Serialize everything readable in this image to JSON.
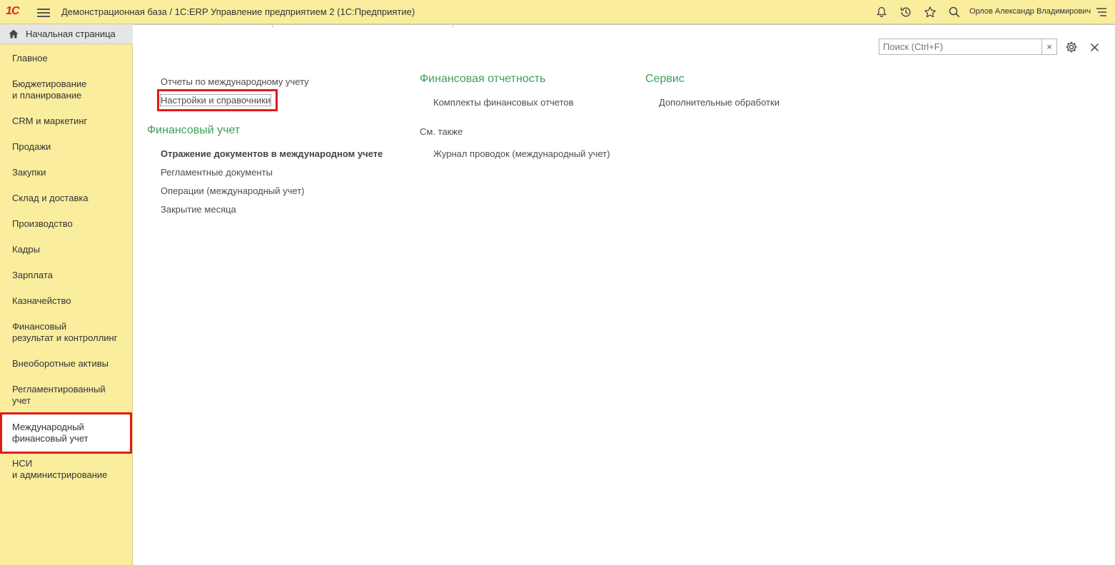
{
  "topbar": {
    "logo": "1С",
    "title": "Демонстрационная база / 1С:ERP Управление предприятием 2  (1С:Предприятие)",
    "user": "Орлов Александр Владимирович",
    "icons": [
      "bell-icon",
      "history-icon",
      "star-icon",
      "search-icon",
      "menu-icon"
    ]
  },
  "sidebar": {
    "home_label": "Начальная страница",
    "items": [
      {
        "label": "Главное"
      },
      {
        "label": "Бюджетирование\nи планирование"
      },
      {
        "label": "CRM и маркетинг"
      },
      {
        "label": "Продажи"
      },
      {
        "label": "Закупки"
      },
      {
        "label": "Склад и доставка"
      },
      {
        "label": "Производство"
      },
      {
        "label": "Кадры"
      },
      {
        "label": "Зарплата"
      },
      {
        "label": "Казначейство"
      },
      {
        "label": "Финансовый\nрезультат и контроллинг"
      },
      {
        "label": "Внеоборотные активы"
      },
      {
        "label": "Регламентированный\nучет"
      },
      {
        "label": "Международный\nфинансовый учет"
      },
      {
        "label": "НСИ\nи администрирование"
      }
    ],
    "active_index": 13
  },
  "search": {
    "placeholder": "Поиск (Ctrl+F)",
    "clear": "×"
  },
  "content": {
    "col1": {
      "links_top": [
        "Отчеты по международному учету",
        "Настройки и справочники"
      ],
      "section_title": "Финансовый учет",
      "links": [
        "Отражение документов в международном учете",
        "Регламентные документы",
        "Операции (международный учет)",
        "Закрытие месяца"
      ]
    },
    "col2": {
      "section_title": "Финансовая отчетность",
      "links": [
        "Комплекты финансовых отчетов"
      ],
      "see_also": "См. также",
      "see_also_links": [
        "Журнал проводок (международный учет)"
      ]
    },
    "col3": {
      "section_title": "Сервис",
      "links": [
        "Дополнительные обработки"
      ]
    }
  },
  "colors": {
    "panel_bg": "#fbed9e",
    "section_green": "#3e9e5a",
    "highlight_red": "#e01b1b",
    "logo_red": "#d52b1e"
  }
}
